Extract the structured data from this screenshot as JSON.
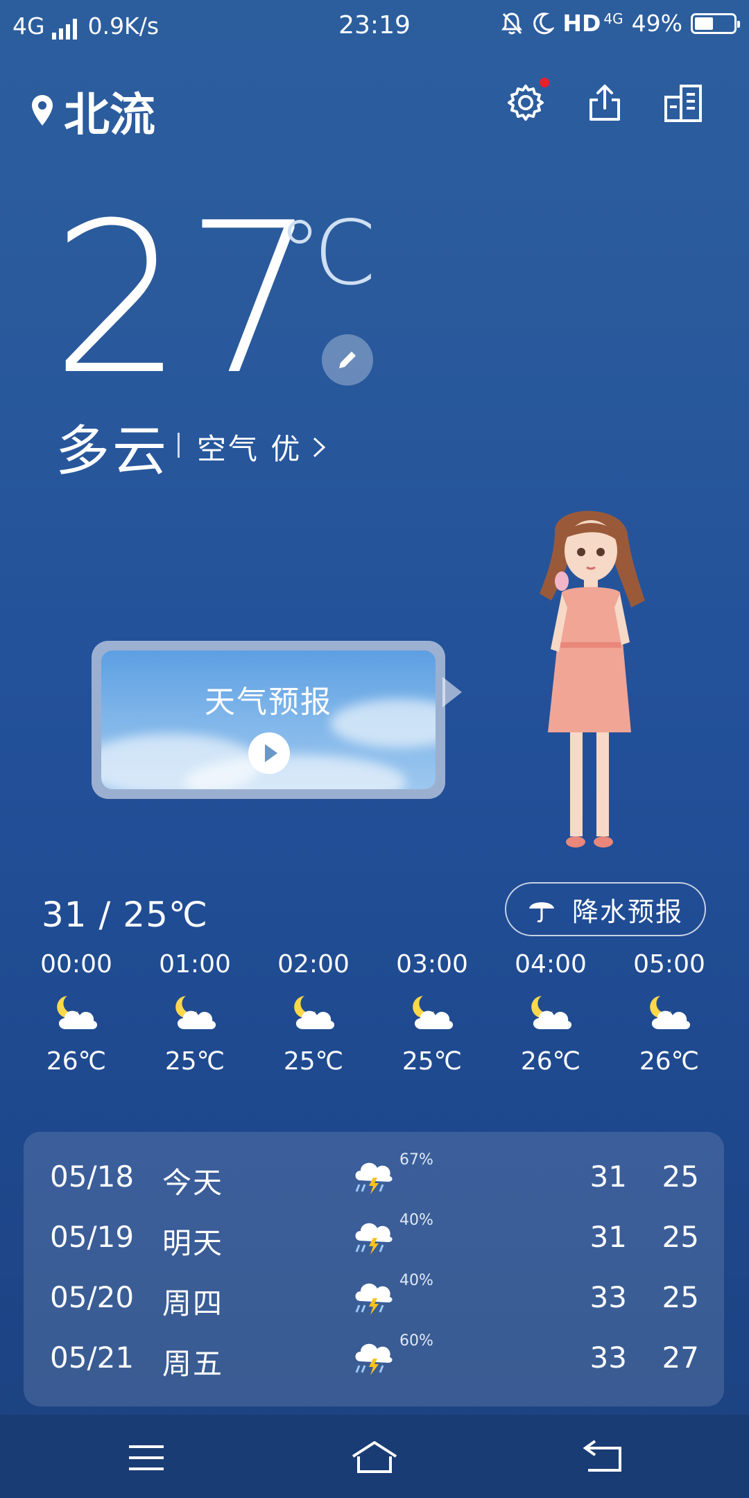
{
  "status_bar": {
    "network": "4G",
    "speed": "0.9K/s",
    "time": "23:19",
    "hd": "HD",
    "net2": "4G",
    "battery": "49%",
    "battery_level": 0.49
  },
  "header": {
    "location": "北流"
  },
  "current": {
    "temp": "27",
    "unit": "℃",
    "condition": "多云",
    "air": "空气 优"
  },
  "video_card": {
    "title": "天气预报"
  },
  "range": "31 / 25℃",
  "rain_button": "降水预报",
  "hourly": [
    {
      "time": "00:00",
      "temp": "26℃"
    },
    {
      "time": "01:00",
      "temp": "25℃"
    },
    {
      "time": "02:00",
      "temp": "25℃"
    },
    {
      "time": "03:00",
      "temp": "25℃"
    },
    {
      "time": "04:00",
      "temp": "26℃"
    },
    {
      "time": "05:00",
      "temp": "26℃"
    }
  ],
  "daily": [
    {
      "date": "05/18",
      "name": "今天",
      "pct": "67%",
      "hi": "31",
      "lo": "25"
    },
    {
      "date": "05/19",
      "name": "明天",
      "pct": "40%",
      "hi": "31",
      "lo": "25"
    },
    {
      "date": "05/20",
      "name": "周四",
      "pct": "40%",
      "hi": "33",
      "lo": "25"
    },
    {
      "date": "05/21",
      "name": "周五",
      "pct": "60%",
      "hi": "33",
      "lo": "27"
    }
  ],
  "icons": {
    "hourly": "partly-cloudy-night-icon",
    "daily": "thunderstorm-icon",
    "nav": [
      "menu-icon",
      "home-icon",
      "back-icon"
    ]
  }
}
